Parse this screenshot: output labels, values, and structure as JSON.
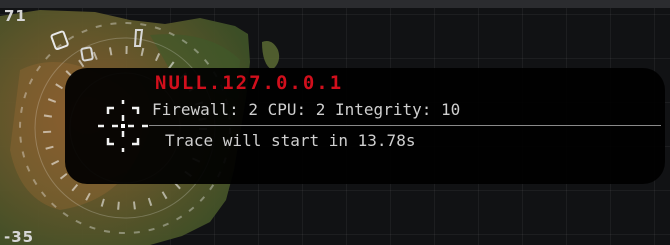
{
  "map": {
    "coord_top": "71",
    "coord_bottom": "-35"
  },
  "target_popup": {
    "title": "NULL.127.0.0.1",
    "stats": "Firewall: 2 CPU: 2 Integrity: 10",
    "trace_message": "Trace will start in 13.78s",
    "icon": "target-reticle-icon"
  },
  "colors": {
    "title_red": "#d10f1c",
    "text_gray": "#cfcfcf",
    "panel_bg": "#000000"
  }
}
